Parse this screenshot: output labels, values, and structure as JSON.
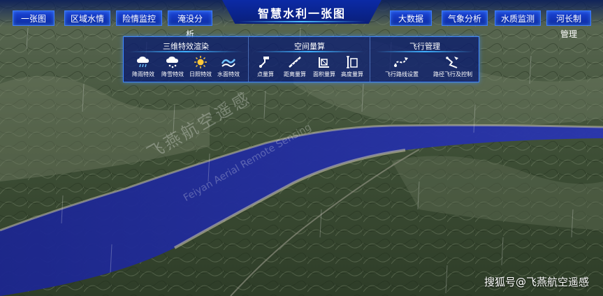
{
  "header": {
    "title": "智慧水利一张图",
    "left_nav": [
      "一张图",
      "区域水情",
      "险情监控",
      "淹没分析"
    ],
    "right_nav": [
      "大数据",
      "气象分析",
      "水质监测",
      "河长制管理"
    ]
  },
  "panel": {
    "groups": [
      {
        "title": "三维特效渲染",
        "tools": [
          {
            "label": "降雨特效",
            "icon": "rain-cloud-icon"
          },
          {
            "label": "降雪特效",
            "icon": "snow-cloud-icon"
          },
          {
            "label": "日照特效",
            "icon": "sun-icon"
          },
          {
            "label": "水面特效",
            "icon": "water-wave-icon"
          }
        ]
      },
      {
        "title": "空间量算",
        "tools": [
          {
            "label": "点量算",
            "icon": "point-measure-icon"
          },
          {
            "label": "距离量算",
            "icon": "distance-measure-icon"
          },
          {
            "label": "面积量算",
            "icon": "area-measure-icon"
          },
          {
            "label": "高度量算",
            "icon": "height-measure-icon"
          }
        ]
      },
      {
        "title": "飞行管理",
        "tools": [
          {
            "label": "飞行路线设置",
            "icon": "flight-route-icon"
          },
          {
            "label": "路径飞行及控制",
            "icon": "path-flight-icon"
          }
        ]
      }
    ]
  },
  "watermark": {
    "corner": "搜狐号@飞燕航空遥感",
    "overlay_cn": "飞燕航空遥感",
    "overlay_en": "Feiyan Aerial Remote Sensing"
  },
  "colors": {
    "nav_blue": "#1b44d8",
    "title_blue": "#0b2aa6",
    "panel_border": "#3d86ff",
    "river": "#1f2a9a"
  }
}
